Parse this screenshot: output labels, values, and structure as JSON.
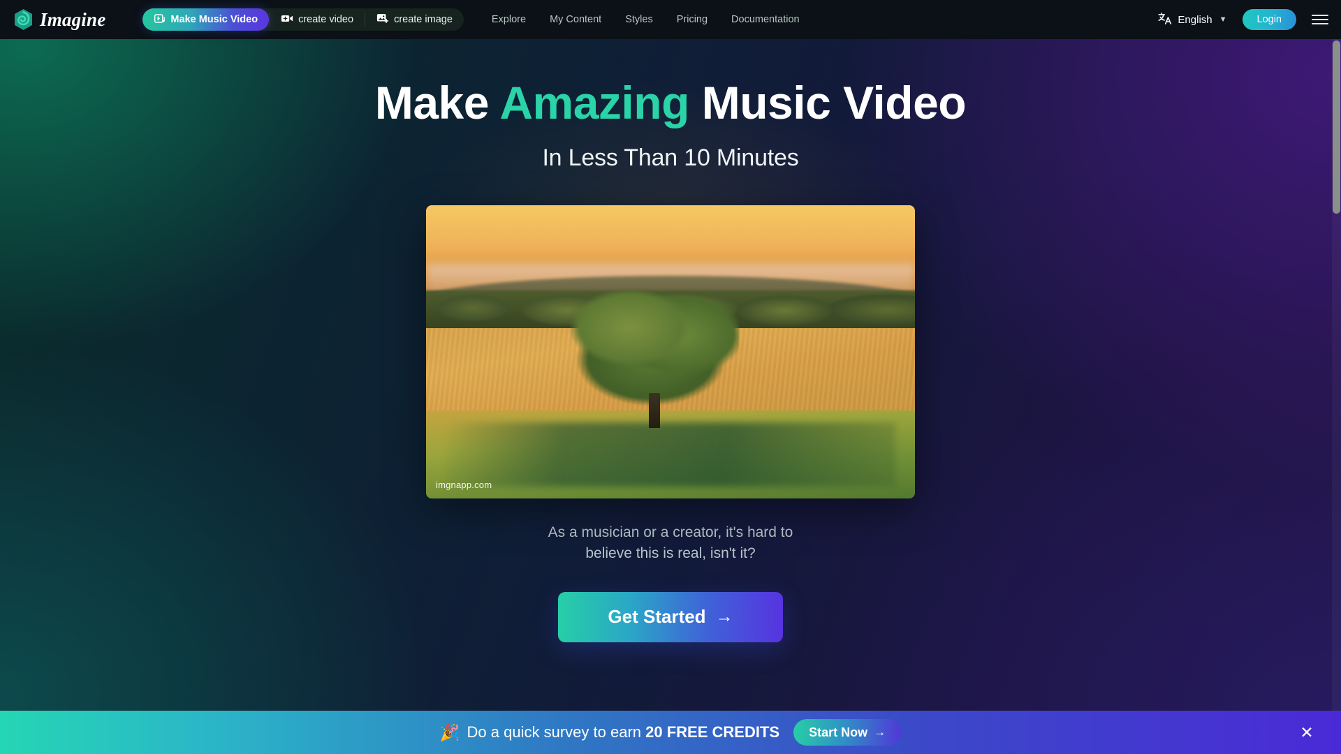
{
  "brand": {
    "name": "Imagine",
    "logo_icon": "imagine-hexagon-logo",
    "accent": "#2ad3a8"
  },
  "navbar": {
    "tabs": [
      {
        "label": "Make Music Video",
        "icon": "music-video-icon",
        "active": true
      },
      {
        "label": "create video",
        "icon": "video-camera-icon",
        "active": false
      },
      {
        "label": "create image",
        "icon": "image-plus-icon",
        "active": false
      }
    ],
    "links": [
      "Explore",
      "My Content",
      "Styles",
      "Pricing",
      "Documentation"
    ],
    "language": {
      "label": "English",
      "icon": "translate-icon",
      "chevron": "chevron-down-icon"
    },
    "login_label": "Login",
    "menu_icon": "hamburger-menu-icon",
    "background": "#0b1117"
  },
  "hero": {
    "headline_pre": "Make ",
    "headline_highlight": "Amazing",
    "headline_post": " Music Video",
    "subhead": "In Less Than 10 Minutes",
    "media": {
      "alt": "lone oak tree in golden sunset field",
      "watermark": "imgnapp.com"
    },
    "caption_line1": "As a musician or a creator, it's hard to",
    "caption_line2": "believe this is real, isn't it?",
    "cta_label": "Get Started",
    "cta_arrow": "→"
  },
  "banner": {
    "emoji": "🎉",
    "text_pre": "Do a quick survey to earn ",
    "text_bold": "20 FREE CREDITS",
    "button_label": "Start Now",
    "button_arrow": "→",
    "close_icon": "close-icon",
    "close_glyph": "✕"
  }
}
